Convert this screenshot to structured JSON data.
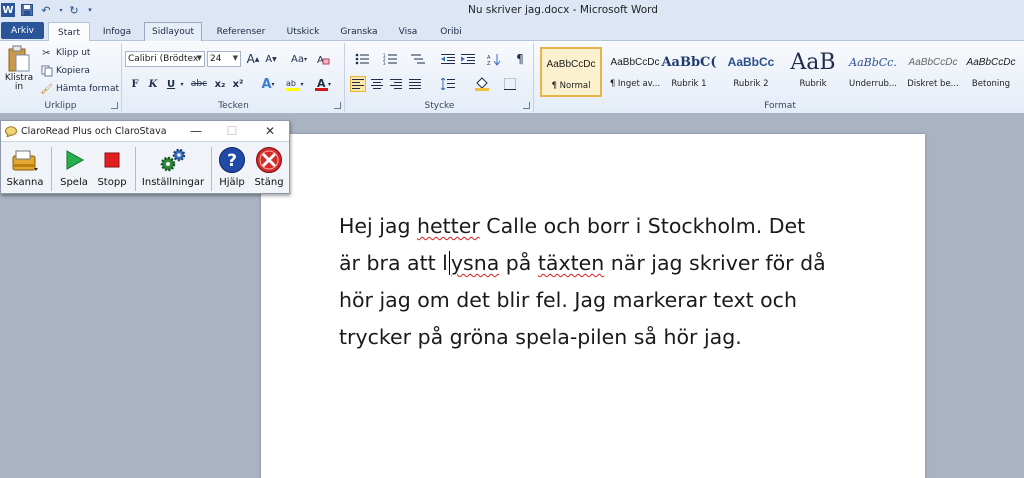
{
  "window": {
    "title": "Nu skriver jag.docx  -  Microsoft Word",
    "word_icon_letter": "W"
  },
  "tabs": [
    {
      "label": "Arkiv"
    },
    {
      "label": "Start"
    },
    {
      "label": "Infoga"
    },
    {
      "label": "Sidlayout"
    },
    {
      "label": "Referenser"
    },
    {
      "label": "Utskick"
    },
    {
      "label": "Granska"
    },
    {
      "label": "Visa"
    },
    {
      "label": "Oribi"
    }
  ],
  "ribbon": {
    "clipboard": {
      "label": "Urklipp",
      "paste": "Klistra",
      "paste_sub": "in",
      "cut": "Klipp ut",
      "copy": "Kopiera",
      "format_painter": "Hämta format"
    },
    "font": {
      "label": "Tecken",
      "font_name": "Calibri (Brödtex",
      "font_size": "24",
      "bold": "F",
      "italic": "K",
      "underline": "U",
      "strike": "abc",
      "sub": "x₂",
      "sup": "x²",
      "grow": "A",
      "shrink": "A",
      "case": "Aa"
    },
    "paragraph": {
      "label": "Stycke"
    },
    "styles": {
      "label": "Format",
      "items": [
        {
          "sample": "AaBbCcDc",
          "name": "¶ Normal"
        },
        {
          "sample": "AaBbCcDc",
          "name": "¶ Inget av..."
        },
        {
          "sample": "AaBbC(",
          "name": "Rubrik 1"
        },
        {
          "sample": "AaBbCc",
          "name": "Rubrik 2"
        },
        {
          "sample": "AaB",
          "name": "Rubrik"
        },
        {
          "sample": "AaBbCc.",
          "name": "Underrub..."
        },
        {
          "sample": "AaBbCcDc",
          "name": "Diskret be..."
        },
        {
          "sample": "AaBbCcDc",
          "name": "Betoning"
        }
      ]
    }
  },
  "claro": {
    "title": "ClaroRead Plus och ClaroStava",
    "buttons": [
      {
        "label": "Skanna"
      },
      {
        "label": "Spela"
      },
      {
        "label": "Stopp"
      },
      {
        "label": "Inställningar"
      },
      {
        "label": "Hjälp"
      },
      {
        "label": "Stäng"
      }
    ]
  },
  "document": {
    "l1a": "Hej jag ",
    "l1b": "hetter",
    "l1c": " Calle och borr i Stockholm. Det",
    "l2a": "är bra att l",
    "l2b": "ysna",
    "l2c": " på ",
    "l2d": "täxten",
    "l2e": " när jag skriver för då",
    "l3": "hör jag om det blir fel. Jag markerar text och",
    "l4": "trycker på gröna spela-pilen så hör jag."
  }
}
